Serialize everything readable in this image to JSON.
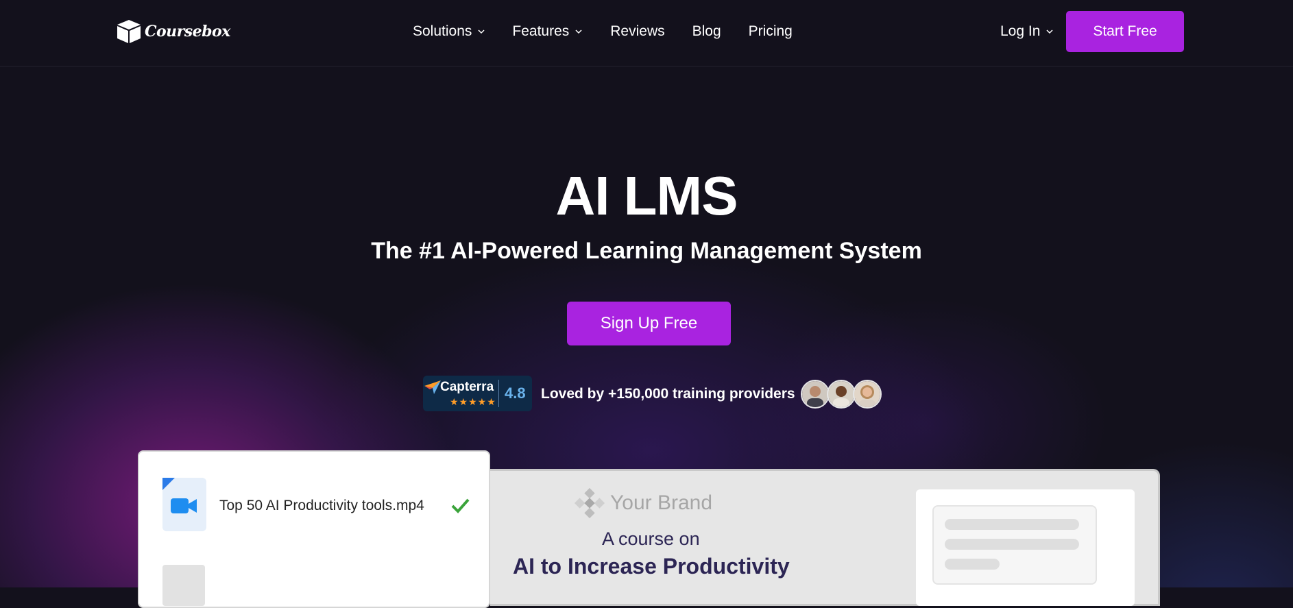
{
  "nav": {
    "logo_text": "Coursebox",
    "menu": [
      {
        "label": "Solutions",
        "has_dropdown": true
      },
      {
        "label": "Features",
        "has_dropdown": true
      },
      {
        "label": "Reviews",
        "has_dropdown": false
      },
      {
        "label": "Blog",
        "has_dropdown": false
      },
      {
        "label": "Pricing",
        "has_dropdown": false
      }
    ],
    "login_label": "Log In",
    "start_label": "Start Free"
  },
  "hero": {
    "title": "AI LMS",
    "subtitle": "The #1 AI-Powered Learning Management System",
    "signup_label": "Sign Up Free",
    "capterra_name": "Capterra",
    "capterra_stars": "★★★★★",
    "capterra_score": "4.8",
    "loved_text": "Loved by +150,000 training providers"
  },
  "file_card": {
    "file_name": "Top 50 AI Productivity tools.mp4"
  },
  "preview": {
    "brand_name": "Your Brand",
    "course_on": "A course on",
    "course_title": "AI to Increase Productivity"
  },
  "colors": {
    "accent": "#a923e0",
    "background": "#13111c",
    "capterra_bg": "#0e2a47",
    "course_text": "#2c2554"
  },
  "icons": [
    "coursebox-logo-icon",
    "chevron-down-icon",
    "capterra-arrow-icon",
    "video-camera-icon",
    "checkmark-icon",
    "brand-logo-icon"
  ]
}
